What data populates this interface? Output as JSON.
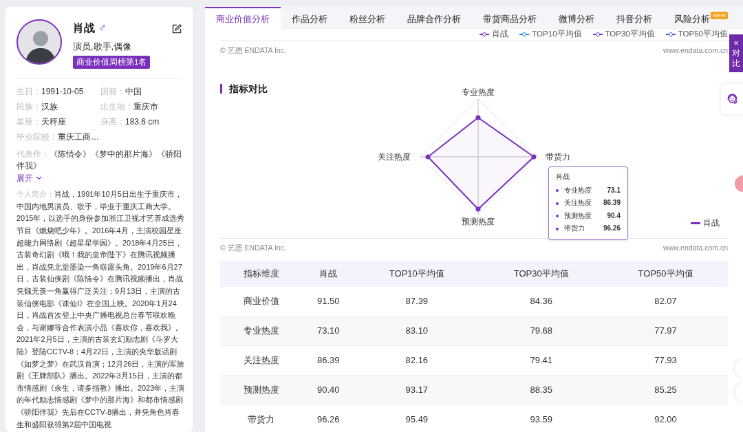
{
  "profile": {
    "name": "肖战",
    "gender_symbol": "♂",
    "roles": "演员,歌手,偶像",
    "rank_badge": "商业价值周榜第1名",
    "facts": [
      {
        "label": "生日：",
        "value": "1991-10-05"
      },
      {
        "label": "国籍：",
        "value": "中国"
      },
      {
        "label": "民族：",
        "value": "汉族"
      },
      {
        "label": "出生地：",
        "value": "重庆市"
      },
      {
        "label": "星座：",
        "value": "天秤座"
      },
      {
        "label": "身高：",
        "value": "183.6 cm"
      }
    ],
    "school": {
      "label": "毕业院校：",
      "value": "重庆工商…"
    },
    "works": {
      "label": "代表作：",
      "value": "《陈情令》《梦中的那片海》《骄阳伴我》"
    },
    "expand": "展开",
    "bio": {
      "label": "个人简介：",
      "text": "肖战，1991年10月5日出生于重庆市，中国内地男演员、歌手，毕业于重庆工商大学。2015年，以选手的身份参加浙江卫视才艺养成选秀节目《燃烧吧少年》。2016年4月，主演校园星座超能力网络剧《超星星学园》。2018年4月25日，古装奇幻剧《哦！我的皇帝陛下》在腾讯视频播出，肖战凭北堂墨染一角崭露头角。2019年6月27日，古装仙侠剧《陈情令》在腾讯视频播出，肖战凭魏无羡一角赢得广泛关注；9月13日，主演的古装仙侠电影《诛仙Ⅰ》在全国上映。2020年1月24日，肖战首次登上中央广播电视总台春节联欢晚会，与谢娜等合作表演小品《喜欢你，喜欢我》。2021年2月5日，主演的古装玄幻励志剧《斗罗大陆》登陆CCTV-8；4月22日，主演的央华版话剧《如梦之梦》在武汉首演；12月26日，主演的军旅剧《王牌部队》播出。2022年3月15日，主演的都市情感剧《余生，请多指教》播出。2023年，主演的年代励志情感剧《梦中的那片海》和都市情感剧《骄阳伴我》先后在CCTV-8播出，并凭角色肖春生和盛阳获得第2届中国电视"
    }
  },
  "tabs": [
    {
      "label": "商业价值分析",
      "selected": true
    },
    {
      "label": "作品分析",
      "selected": false
    },
    {
      "label": "粉丝分析",
      "selected": false
    },
    {
      "label": "品牌合作分析",
      "selected": false
    },
    {
      "label": "带货商品分析",
      "selected": false
    },
    {
      "label": "微博分析",
      "selected": false
    },
    {
      "label": "抖音分析",
      "selected": false
    },
    {
      "label": "风险分析",
      "selected": false,
      "badge": "NEW"
    }
  ],
  "top_legend": [
    {
      "label": "肖战",
      "color": "#7b2fbe"
    },
    {
      "label": "TOP10平均值",
      "color": "#1e88e5"
    },
    {
      "label": "TOP30平均值",
      "color": "#6a3fc0"
    },
    {
      "label": "TOP50平均值",
      "color": "#4f5bd5"
    }
  ],
  "top_footer": {
    "copyright": "© 艺恩 ENDATA Inc.",
    "site": "www.endata.com.cn"
  },
  "radar": {
    "title": "指标对比",
    "axes": [
      "专业热度",
      "带货力",
      "预测热度",
      "关注热度"
    ],
    "tooltip": {
      "title": "肖战",
      "rows": [
        {
          "label": "专业热度",
          "value": "73.1"
        },
        {
          "label": "关注热度",
          "value": "86.39"
        },
        {
          "label": "预测热度",
          "value": "90.4"
        },
        {
          "label": "带货力",
          "value": "96.26"
        }
      ]
    },
    "legend": {
      "label": "肖战",
      "color": "#7b2fbe"
    },
    "footer": {
      "copyright": "© 艺恩 ENDATA Inc.",
      "site": "www.endata.com.cn"
    }
  },
  "table": {
    "columns": [
      "指标维度",
      "肖战",
      "TOP10平均值",
      "TOP30平均值",
      "TOP50平均值"
    ],
    "rows": [
      [
        "商业价值",
        "91.50",
        "87.39",
        "84.36",
        "82.07"
      ],
      [
        "专业热度",
        "73.10",
        "83.10",
        "79.68",
        "77.97"
      ],
      [
        "关注热度",
        "86.39",
        "82.16",
        "79.41",
        "77.93"
      ],
      [
        "预测热度",
        "90.40",
        "93.17",
        "88.35",
        "85.25"
      ],
      [
        "带货力",
        "96.26",
        "95.49",
        "93.59",
        "92.00"
      ]
    ]
  },
  "compare_tab": {
    "arrow": "«",
    "label": "对比"
  }
}
